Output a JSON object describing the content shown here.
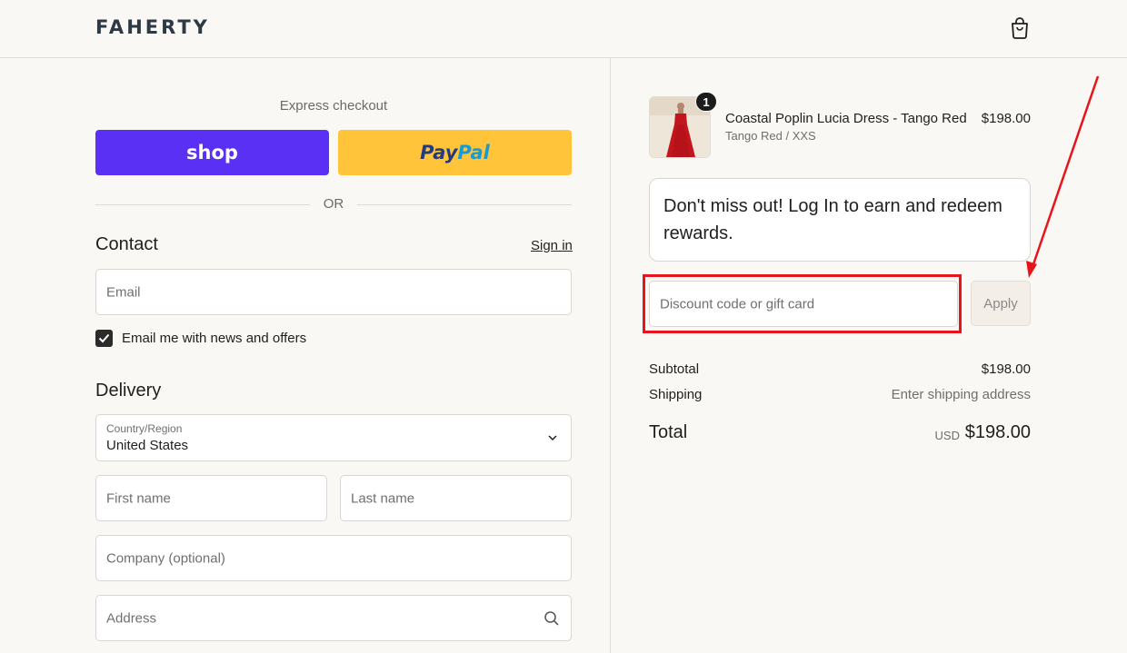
{
  "header": {
    "logo": "FAHERTY",
    "cart_icon": "shopping-bag-icon"
  },
  "express": {
    "title": "Express checkout",
    "shop_label": "shop",
    "paypal_part1": "Pay",
    "paypal_part2": "Pal",
    "or_label": "OR"
  },
  "contact": {
    "title": "Contact",
    "signin": "Sign in",
    "email_placeholder": "Email",
    "newsletter_label": "Email me with news and offers",
    "newsletter_checked": true
  },
  "delivery": {
    "title": "Delivery",
    "country_label": "Country/Region",
    "country_value": "United States",
    "first_name_placeholder": "First name",
    "last_name_placeholder": "Last name",
    "company_placeholder": "Company (optional)",
    "address_placeholder": "Address"
  },
  "order": {
    "quantity": "1",
    "product_name": "Coastal Poplin Lucia Dress - Tango Red",
    "variant": "Tango Red / XXS",
    "price": "$198.00",
    "rewards_text": "Don't miss out! Log In to earn and redeem rewards.",
    "discount_placeholder": "Discount code or gift card",
    "apply_label": "Apply",
    "subtotal_label": "Subtotal",
    "subtotal_value": "$198.00",
    "shipping_label": "Shipping",
    "shipping_value": "Enter shipping address",
    "total_label": "Total",
    "total_currency": "USD",
    "total_value": "$198.00"
  },
  "colors": {
    "shop_purple": "#5a31f4",
    "paypal_yellow": "#ffc439",
    "annotation_red": "#e8141b",
    "background": "#faf8f4"
  }
}
